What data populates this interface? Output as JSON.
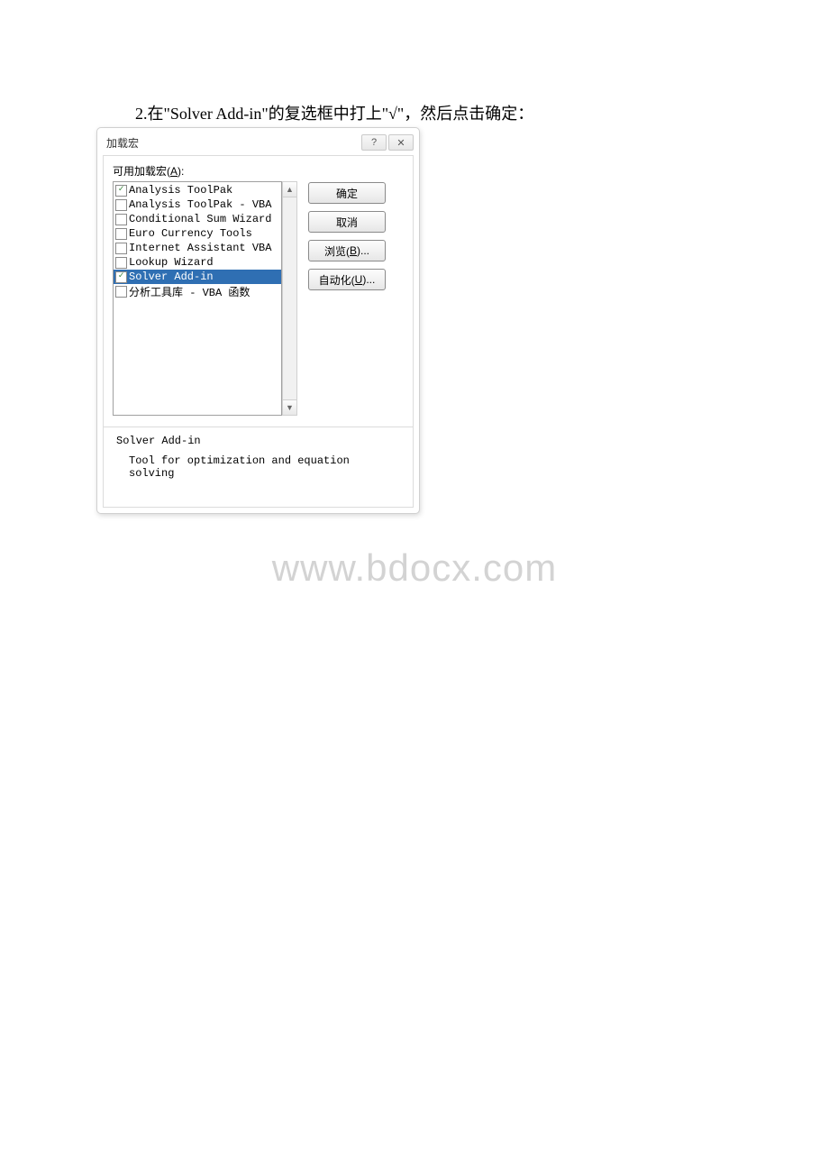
{
  "instruction_text": "2.在\"Solver Add-in\"的复选框中打上\"√\"，然后点击确定：",
  "dialog": {
    "title": "加载宏",
    "help_glyph": "?",
    "close_glyph": "✕",
    "addins_label_prefix": "可用加载宏(",
    "addins_label_key": "A",
    "addins_label_suffix": "):",
    "items": [
      {
        "label": "Analysis ToolPak",
        "checked": true,
        "selected": false
      },
      {
        "label": "Analysis ToolPak - VBA",
        "checked": false,
        "selected": false
      },
      {
        "label": "Conditional Sum Wizard",
        "checked": false,
        "selected": false
      },
      {
        "label": "Euro Currency Tools",
        "checked": false,
        "selected": false
      },
      {
        "label": "Internet Assistant VBA",
        "checked": false,
        "selected": false
      },
      {
        "label": "Lookup Wizard",
        "checked": false,
        "selected": false
      },
      {
        "label": "Solver Add-in",
        "checked": true,
        "selected": true
      },
      {
        "label": "分析工具库 - VBA 函数",
        "checked": false,
        "selected": false
      }
    ],
    "scroll_up_glyph": "▲",
    "scroll_down_glyph": "▼",
    "check_glyph": "✓",
    "buttons": {
      "ok": "确定",
      "cancel": "取消",
      "browse_prefix": "浏览(",
      "browse_key": "B",
      "browse_suffix": ")...",
      "automate_prefix": "自动化(",
      "automate_key": "U",
      "automate_suffix": ")..."
    },
    "desc_title": "Solver Add-in",
    "desc_body": "Tool for optimization and equation solving"
  },
  "watermark": "www.bdocx.com"
}
